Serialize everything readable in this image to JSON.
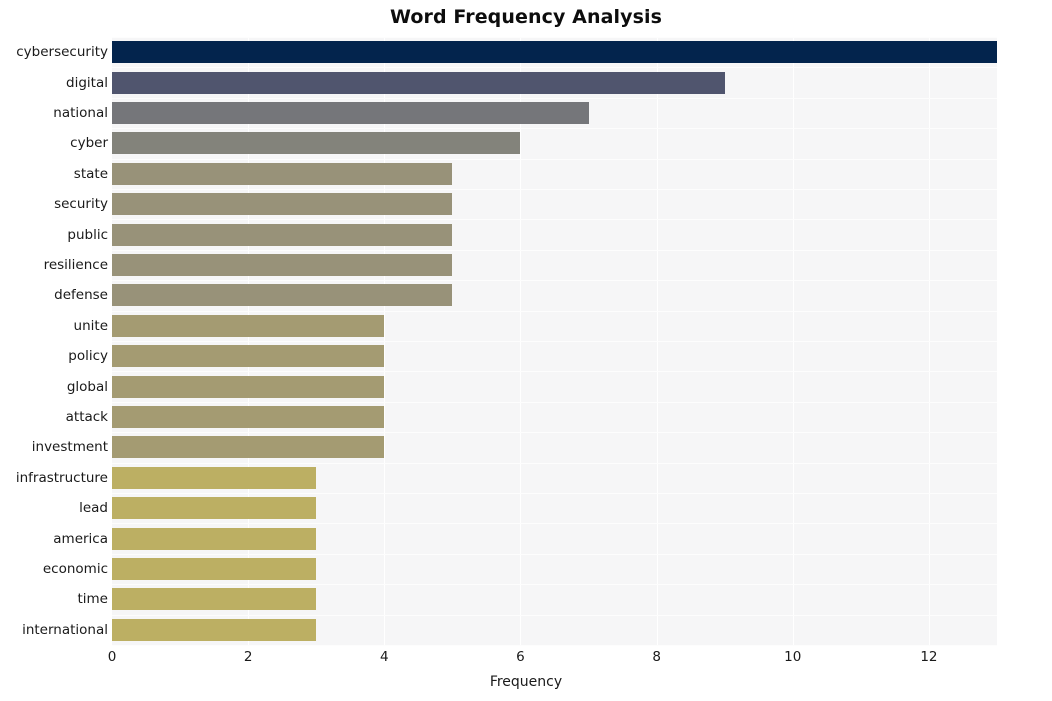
{
  "chart_data": {
    "type": "bar",
    "orientation": "horizontal",
    "title": "Word Frequency Analysis",
    "xlabel": "Frequency",
    "ylabel": "",
    "xlim": [
      0,
      13
    ],
    "ylim": [
      0,
      20
    ],
    "grid": true,
    "legend": null,
    "xticks": [
      0,
      2,
      4,
      6,
      8,
      10,
      12
    ],
    "xtick_labels": [
      "0",
      "2",
      "4",
      "6",
      "8",
      "10",
      "12"
    ],
    "categories": [
      "cybersecurity",
      "digital",
      "national",
      "cyber",
      "state",
      "security",
      "public",
      "resilience",
      "defense",
      "unite",
      "policy",
      "global",
      "attack",
      "investment",
      "infrastructure",
      "lead",
      "america",
      "economic",
      "time",
      "international"
    ],
    "values": [
      13,
      9,
      7,
      6,
      5,
      5,
      5,
      5,
      5,
      4,
      4,
      4,
      4,
      4,
      3,
      3,
      3,
      3,
      3,
      3
    ],
    "bar_colors": [
      "#03244d",
      "#50556e",
      "#75767a",
      "#83837b",
      "#989279",
      "#989279",
      "#989279",
      "#989279",
      "#989279",
      "#a49b72",
      "#a49b72",
      "#a49b72",
      "#a49b72",
      "#a49b72",
      "#bcaf63",
      "#bcaf63",
      "#bcaf63",
      "#bcaf63",
      "#bcaf63",
      "#bcaf63"
    ]
  },
  "style": {
    "figure_background": "#ffffff",
    "plot_background": "#f6f6f7",
    "grid_color": "#ffffff",
    "title_color": "#0d0d0d",
    "tick_label_color": "#1a1a1a"
  }
}
